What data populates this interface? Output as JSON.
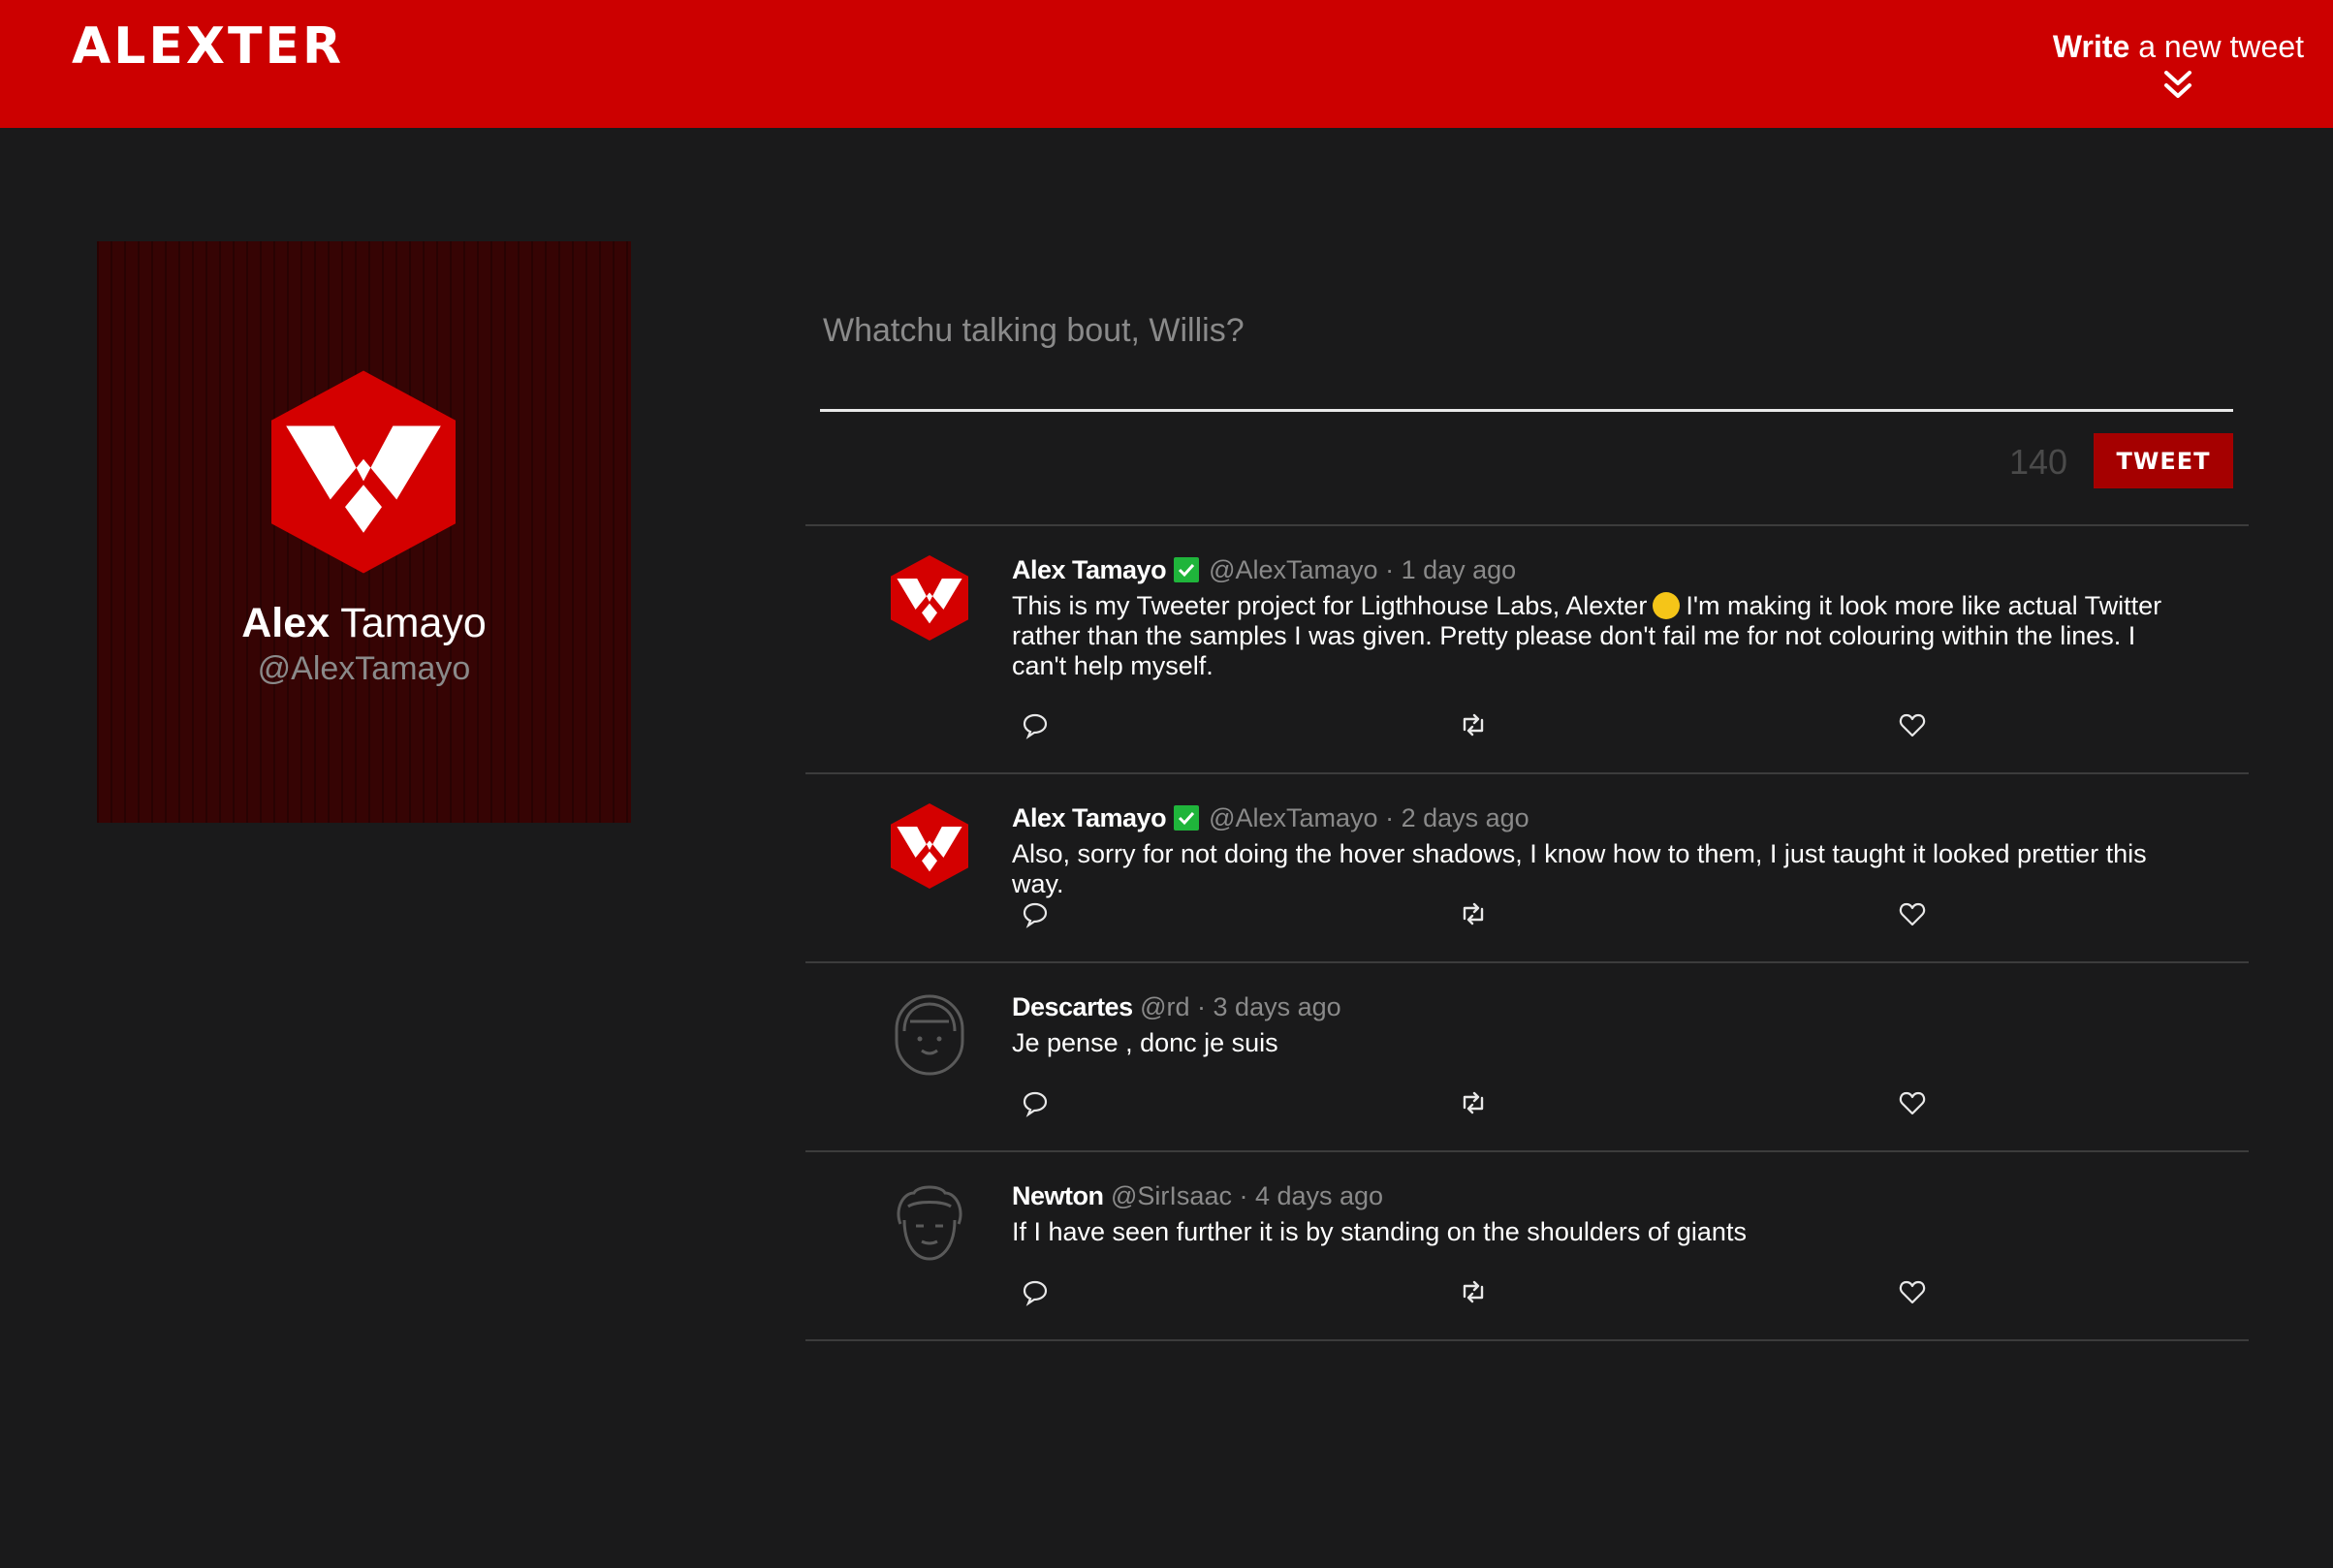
{
  "header": {
    "logo": "ALEXTER",
    "write_bold": "Write",
    "write_rest": " a new tweet"
  },
  "profile": {
    "first_name": "Alex",
    "last_name": " Tamayo",
    "handle": "@AlexTamayo"
  },
  "compose": {
    "placeholder": "Whatchu talking bout, Willis?",
    "counter": "140",
    "button_label": "TWEET"
  },
  "tweets": [
    {
      "name": "Alex Tamayo",
      "verified": true,
      "handle": "@AlexTamayo",
      "time": "1 day ago",
      "text_before_emoji": "This is my Tweeter project for Ligthhouse Labs, Alexter",
      "emoji": "grinning-squinting-face",
      "text_after_emoji": "I'm making it look more like actual Twitter rather than the samples I was given. Pretty please don't fail me for not colouring within the lines. I can't help myself."
    },
    {
      "name": "Alex Tamayo",
      "verified": true,
      "handle": "@AlexTamayo",
      "time": "2 days ago",
      "text": "Also, sorry for not doing the hover shadows, I know how to them, I just taught it looked prettier this way."
    },
    {
      "name": "Descartes",
      "verified": false,
      "handle": "@rd",
      "time": "3 days ago",
      "text": "Je pense , donc je suis"
    },
    {
      "name": "Newton",
      "verified": false,
      "handle": "@SirIsaac",
      "time": "4 days ago",
      "text": "If I have seen further it is by standing on the shoulders of giants"
    }
  ],
  "separator": " · ",
  "icons": {
    "comment": "comment-icon",
    "retweet": "retweet-icon",
    "like": "heart-icon",
    "verified": "verified-check-icon",
    "expand": "double-chevron-down-icon"
  },
  "colors": {
    "brand_red": "#cc0000",
    "background": "#1a1a1b",
    "profile_bg": "#360404",
    "button_red": "#a50000",
    "verified_green": "#1fb53b"
  }
}
